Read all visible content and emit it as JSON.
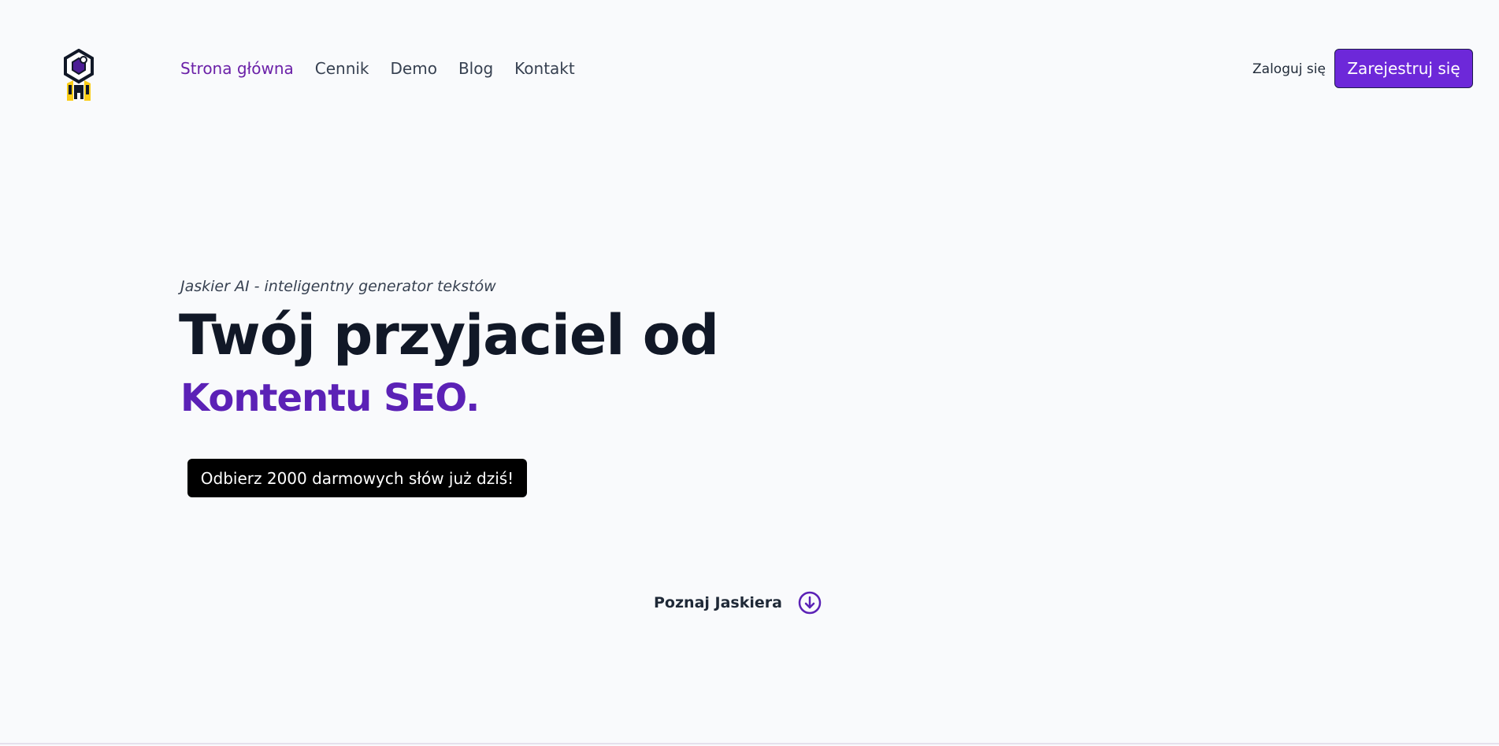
{
  "colors": {
    "accent": "#6d28d9",
    "accent_text": "#5b21b6",
    "nav_active": "#6b21a8",
    "logo_yellow": "#facc15",
    "dark": "#111827"
  },
  "header": {
    "logo_icon": "hexagon-rocket-logo",
    "nav": [
      {
        "label": "Strona główna",
        "active": true
      },
      {
        "label": "Cennik",
        "active": false
      },
      {
        "label": "Demo",
        "active": false
      },
      {
        "label": "Blog",
        "active": false
      },
      {
        "label": "Kontakt",
        "active": false
      }
    ],
    "login_label": "Zaloguj się",
    "register_label": "Zarejestruj się"
  },
  "hero": {
    "tagline": "Jaskier AI - inteligentny generator tekstów",
    "headline": "Twój przyjaciel od",
    "headline_accent": "Kontentu SEO.",
    "cta_label": "Odbierz 2000 darmowych słów już dziś!",
    "learn_more_label": "Poznaj Jaskiera",
    "learn_more_icon": "arrow-down-circle-icon"
  }
}
